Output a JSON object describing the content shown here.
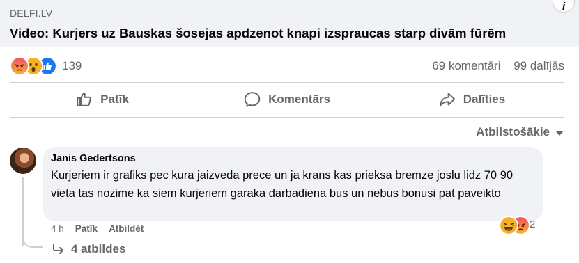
{
  "link_preview": {
    "source": "DELFI.LV",
    "headline": "Video: Kurjers uz Bauskas šosejas apdzenot knapi izspraucas starp divām fūrēm"
  },
  "post_stats": {
    "reaction_count": "139",
    "comments": "69 komentāri",
    "shares": "99 dalījās"
  },
  "actions": {
    "like": "Patīk",
    "comment": "Komentārs",
    "share": "Dalīties"
  },
  "sort": {
    "label": "Atbilstošākie"
  },
  "comment": {
    "author": "Janis Gedertsons",
    "text": "Kurjeriem ir grafiks pec kura jaizveda prece un ja krans kas prieksa bremze joslu lidz 70 90 vieta tas nozime ka siem kurjeriem garaka darbadiena bus un nebus bonusi pat paveikto",
    "time": "4 h",
    "like": "Patīk",
    "reply": "Atbildēt",
    "reaction_count": "2",
    "replies": "4 atbildes"
  },
  "colors": {
    "secondary_text": "#65676b",
    "bubble_bg": "#f0f2f5",
    "like_blue": "#1877f2",
    "angry_red": "#e9710f",
    "wow_yellow": "#f7b125"
  },
  "icons": [
    "angry-reaction-icon",
    "wow-reaction-icon",
    "like-reaction-icon",
    "thumbs-up-icon",
    "comment-bubble-icon",
    "share-arrow-icon",
    "chevron-down-icon",
    "reply-arrow-icon",
    "haha-reaction-icon"
  ]
}
